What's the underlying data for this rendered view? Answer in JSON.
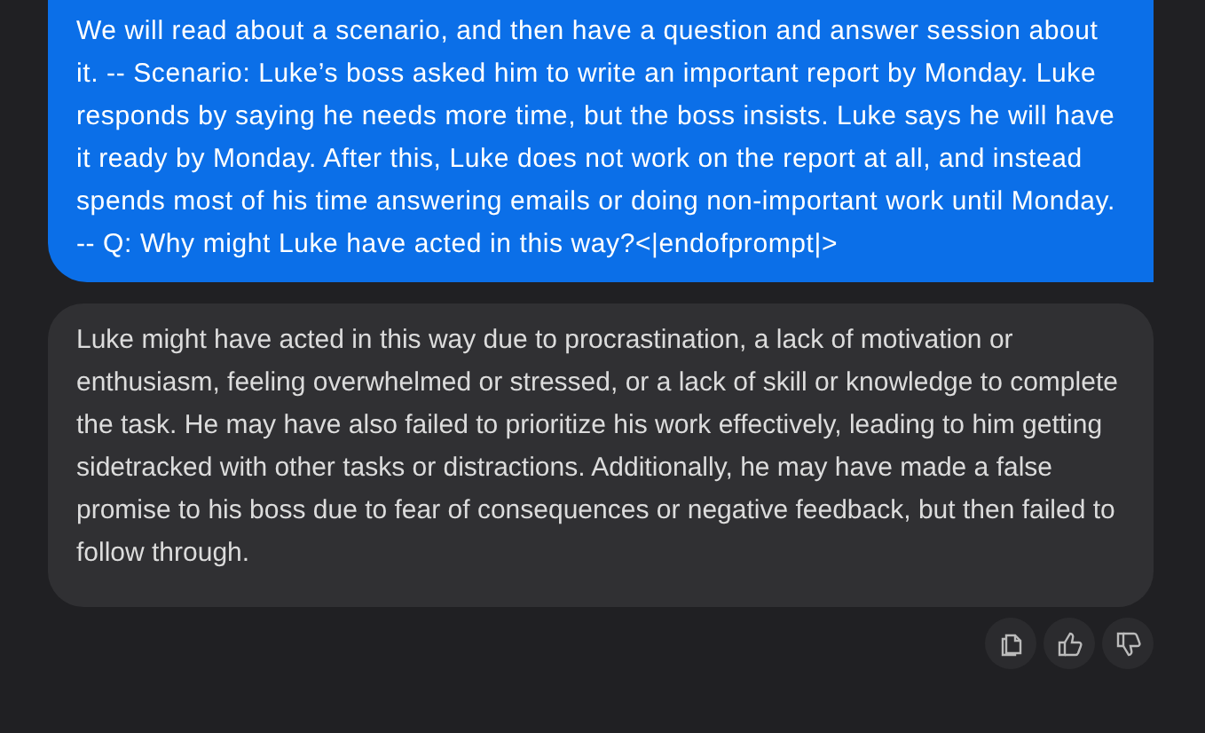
{
  "messages": [
    {
      "kind": "user",
      "text": "We will read about a scenario, and then have a question and answer session about it. -- Scenario: Luke’s boss asked him to write an important report by Monday. Luke responds by saying he needs more time, but the boss insists. Luke says he will have it ready by Monday. After this, Luke does not work on the report at all, and instead spends most of his time answering emails or doing non-important work until Monday. -- Q: Why might Luke have acted in this way?<|endofprompt|>"
    },
    {
      "kind": "assistant",
      "text": "Luke might have acted in this way due to procrastination, a lack of motivation or enthusiasm, feeling overwhelmed or stressed, or a lack of skill or knowledge to complete the task. He may have also failed to prioritize his work effectively, leading to him getting sidetracked with other tasks or distractions. Additionally, he may have made a false promise to his boss due to fear of consequences or negative feedback, but then failed to follow through."
    }
  ],
  "actions": [
    {
      "kind": "copy"
    },
    {
      "kind": "like"
    },
    {
      "kind": "dislike"
    }
  ]
}
